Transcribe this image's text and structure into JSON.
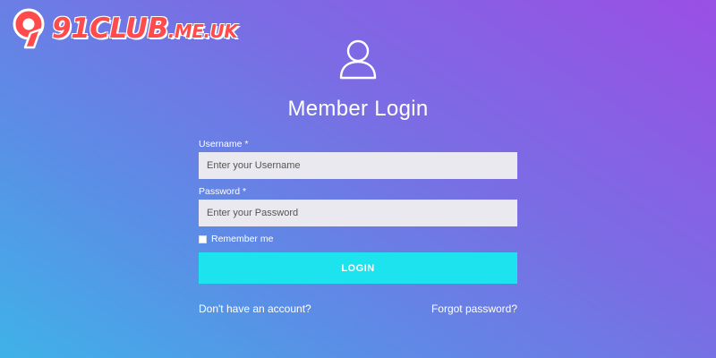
{
  "logo": {
    "main_text": "91CLUB",
    "domain_text": ".ME.UK",
    "brand_color": "#ff4b4b"
  },
  "header": {
    "icon": "user-icon",
    "title": "Member Login"
  },
  "form": {
    "username": {
      "label": "Username *",
      "placeholder": "Enter your Username",
      "value": ""
    },
    "password": {
      "label": "Password *",
      "placeholder": "Enter your Password",
      "value": ""
    },
    "remember_label": "Remember me",
    "remember_checked": false,
    "login_label": "LOGIN"
  },
  "links": {
    "signup": "Don't have an account?",
    "forgot": "Forgot password?"
  },
  "colors": {
    "gradient_start": "#3fb2e8",
    "gradient_end": "#9a4fe4",
    "button": "#1de3ee",
    "input_bg": "#e9e9ef"
  }
}
